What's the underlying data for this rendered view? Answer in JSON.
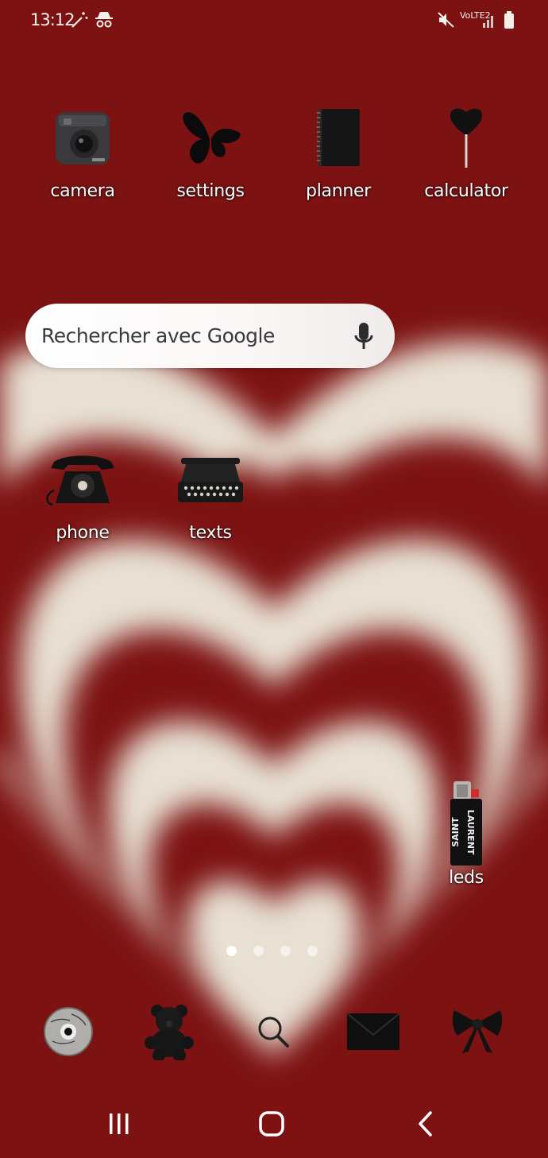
{
  "status_bar": {
    "time": "13:12",
    "network_label": "VoLTE2",
    "left_icons": [
      "magic-wand-icon",
      "incognito-icon"
    ],
    "right_icons": [
      "mute-icon",
      "signal-icon",
      "battery-icon"
    ]
  },
  "home_apps": [
    {
      "label": "camera",
      "icon": "instant-camera-icon"
    },
    {
      "label": "settings",
      "icon": "butterfly-icon"
    },
    {
      "label": "planner",
      "icon": "notebook-icon"
    },
    {
      "label": "calculator",
      "icon": "heart-lollipop-icon"
    },
    {
      "label": "phone",
      "icon": "rotary-phone-icon"
    },
    {
      "label": "texts",
      "icon": "typewriter-icon"
    },
    {
      "label": "leds",
      "icon": "lighter-icon"
    }
  ],
  "search": {
    "placeholder": "Rechercher avec Google",
    "icon": "mic-icon"
  },
  "page_indicator": {
    "pages": 4,
    "active": 1
  },
  "dock": [
    {
      "icon": "cd-disc-icon"
    },
    {
      "icon": "teddy-bear-icon"
    },
    {
      "icon": "search-icon"
    },
    {
      "icon": "envelope-icon"
    },
    {
      "icon": "bow-icon"
    }
  ],
  "nav_bar": [
    "recents-icon",
    "home-icon",
    "back-icon"
  ],
  "colors": {
    "wallpaper_red": "#7d1212",
    "wallpaper_cream": "#e8e0d3"
  }
}
